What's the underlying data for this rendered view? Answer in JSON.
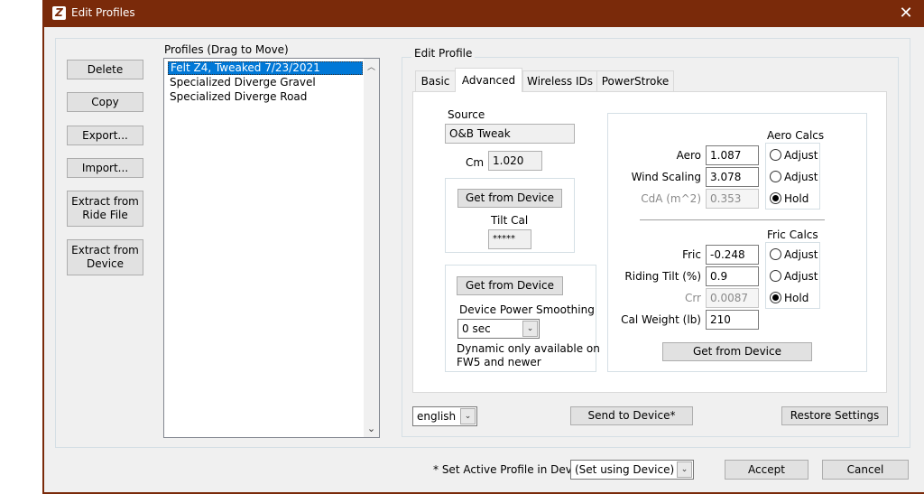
{
  "window": {
    "title": "Edit Profiles",
    "accent": "#7a2a0a"
  },
  "profiles": {
    "header": "Profiles (Drag to Move)",
    "items": [
      "Felt Z4, Tweaked 7/23/2021",
      "Specialized Diverge Gravel",
      "Specialized Diverge Road"
    ],
    "selected_index": 0
  },
  "left_buttons": {
    "delete": "Delete",
    "copy": "Copy",
    "export": "Export...",
    "import": "Import...",
    "extract_ride_1": "Extract from",
    "extract_ride_2": "Ride File",
    "extract_device_1": "Extract from",
    "extract_device_2": "Device"
  },
  "edit_profile": {
    "group_label": "Edit Profile",
    "tabs": [
      "Basic",
      "Advanced",
      "Wireless IDs",
      "PowerStroke"
    ],
    "active_tab": "Advanced",
    "source_label": "Source",
    "source_value": "O&B Tweak",
    "cm_label": "Cm",
    "cm_value": "1.020",
    "tilt_get_button": "Get from Device",
    "tilt_cal_label": "Tilt Cal",
    "tilt_cal_value": "*****",
    "smoothing_get_button": "Get from Device",
    "smoothing_label": "Device Power Smoothing",
    "smoothing_value": "0 sec",
    "dynamic_note_1": "Dynamic only available on",
    "dynamic_note_2": "FW5 and newer",
    "aero_calcs_label": "Aero Calcs",
    "aero_label": "Aero",
    "aero_value": "1.087",
    "wind_label": "Wind Scaling",
    "wind_value": "3.078",
    "cda_label": "CdA (m^2)",
    "cda_value": "0.353",
    "aero_radio": [
      "Adjust",
      "Adjust",
      "Hold"
    ],
    "aero_radio_selected": 2,
    "fric_calcs_label": "Fric Calcs",
    "fric_label": "Fric",
    "fric_value": "-0.248",
    "tilt_label": "Riding Tilt (%)",
    "tilt_value": "0.9",
    "crr_label": "Crr",
    "crr_value": "0.0087",
    "fric_radio": [
      "Adjust",
      "Adjust",
      "Hold"
    ],
    "fric_radio_selected": 2,
    "cal_weight_label": "Cal Weight (lb)",
    "cal_weight_value": "210",
    "main_get_button": "Get from Device"
  },
  "bottom": {
    "language": "english",
    "send_button": "Send to Device*",
    "restore_button": "Restore Settings",
    "active_profile_label": "* Set Active Profile in Device",
    "active_profile_value": "(Set using Device)",
    "accept_button": "Accept",
    "cancel_button": "Cancel"
  }
}
